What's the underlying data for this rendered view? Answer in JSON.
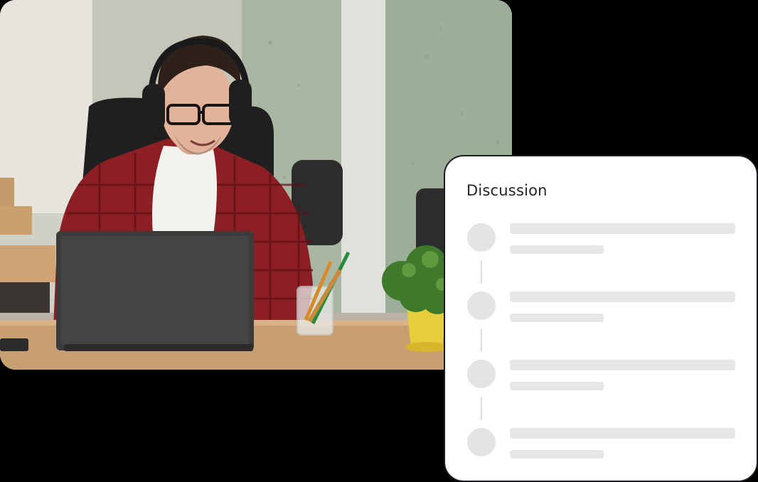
{
  "photo": {
    "subject": "man-with-headphones-using-laptop"
  },
  "discussion": {
    "title": "Discussion",
    "items": [
      {
        "kind": "skeleton"
      },
      {
        "kind": "skeleton"
      },
      {
        "kind": "skeleton"
      },
      {
        "kind": "skeleton"
      }
    ]
  },
  "colors": {
    "card_background": "#ffffff",
    "skeleton": "#e6e7e9",
    "page_background": "#000000",
    "title_text": "#23252b"
  }
}
